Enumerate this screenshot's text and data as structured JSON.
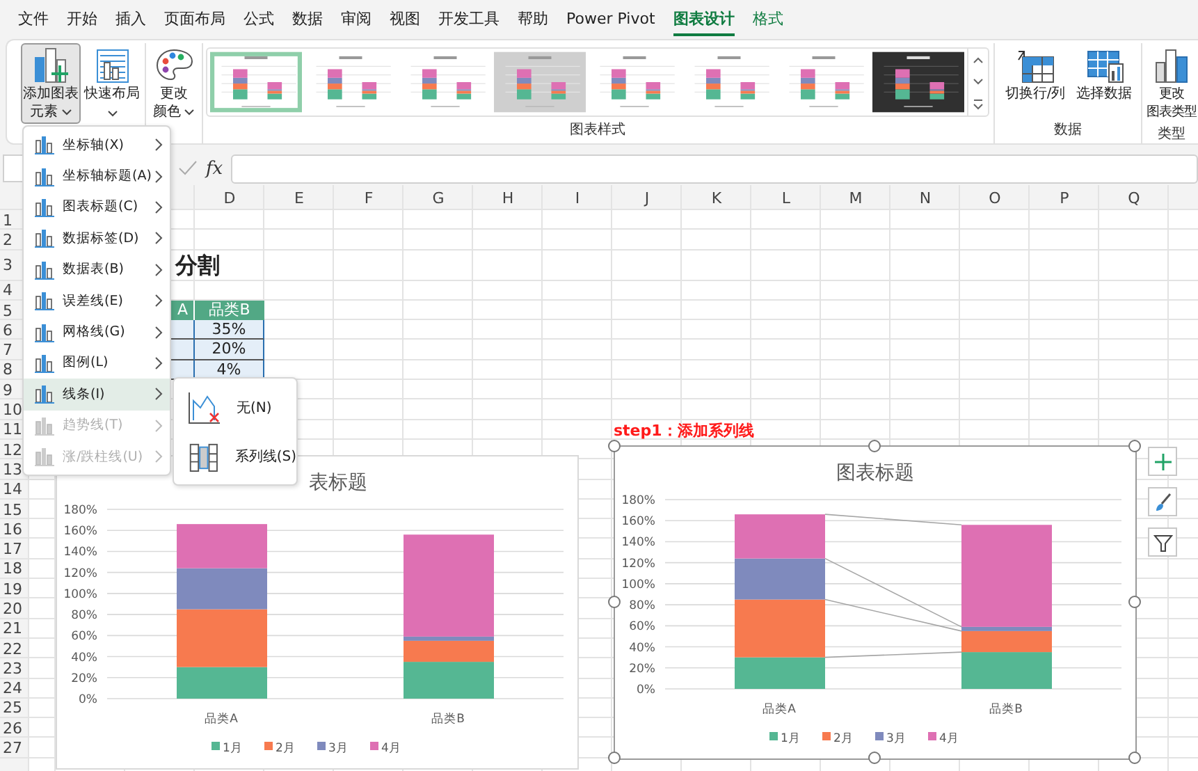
{
  "tabs": [
    {
      "label": "文件",
      "selected": false,
      "contextual": false
    },
    {
      "label": "开始",
      "selected": false,
      "contextual": false
    },
    {
      "label": "插入",
      "selected": false,
      "contextual": false
    },
    {
      "label": "页面布局",
      "selected": false,
      "contextual": false
    },
    {
      "label": "公式",
      "selected": false,
      "contextual": false
    },
    {
      "label": "数据",
      "selected": false,
      "contextual": false
    },
    {
      "label": "审阅",
      "selected": false,
      "contextual": false
    },
    {
      "label": "视图",
      "selected": false,
      "contextual": false
    },
    {
      "label": "开发工具",
      "selected": false,
      "contextual": false
    },
    {
      "label": "帮助",
      "selected": false,
      "contextual": false
    },
    {
      "label": "Power Pivot",
      "selected": false,
      "contextual": false
    },
    {
      "label": "图表设计",
      "selected": true,
      "contextual": true
    },
    {
      "label": "格式",
      "selected": false,
      "contextual": true
    }
  ],
  "ribbon": {
    "layout_buttons": [
      {
        "lines": [
          "添加图表",
          "元素"
        ],
        "dropdown": true,
        "pressed": true
      },
      {
        "lines": [
          "快速布局"
        ],
        "dropdown": true,
        "pressed": false
      }
    ],
    "color_button": {
      "lines": [
        "更改",
        "颜色"
      ],
      "dropdown": true,
      "pressed": false
    },
    "styles": [
      {
        "kind": "plain",
        "selected": true
      },
      {
        "kind": "plain",
        "selected": false
      },
      {
        "kind": "plain",
        "selected": false
      },
      {
        "kind": "gray",
        "selected": false
      },
      {
        "kind": "plain",
        "selected": false
      },
      {
        "kind": "plain",
        "selected": false
      },
      {
        "kind": "plain",
        "selected": false
      },
      {
        "kind": "dark",
        "selected": false
      }
    ],
    "styles_label": "图表样式",
    "data_buttons": [
      {
        "lines": [
          "切换行/列"
        ]
      },
      {
        "lines": [
          "选择数据"
        ]
      }
    ],
    "data_label": "数据",
    "type_button": {
      "lines": [
        "更改",
        "图表类型"
      ]
    },
    "type_label": "类型"
  },
  "formula_bar": {
    "fx": "fx"
  },
  "sheet": {
    "column_headers": [
      "D",
      "E",
      "F",
      "G",
      "H",
      "I",
      "J",
      "K",
      "L",
      "M",
      "N",
      "O",
      "P",
      "Q"
    ],
    "row_headers": [
      "1",
      "2",
      "3",
      "4",
      "5",
      "6",
      "7",
      "8",
      "9",
      "10",
      "11",
      "12",
      "13",
      "14",
      "15",
      "16",
      "17",
      "18",
      "19",
      "20",
      "21",
      "22",
      "23",
      "24",
      "25",
      "26",
      "27"
    ],
    "title": "分割",
    "table": {
      "header": [
        "A",
        "品类B"
      ],
      "values": [
        "35%",
        "20%",
        "4%"
      ]
    },
    "note": "step1：添加系列线",
    "charts": [
      {
        "selected": false,
        "series_lines": false,
        "title_clipped": true,
        "chart_data": {
          "type": "bar",
          "stacked": true,
          "grid": true,
          "legend": true,
          "title": "表标题",
          "categories": [
            "品类A",
            "品类B"
          ],
          "ylim": [
            0,
            180
          ],
          "yticks": [
            {
              "value": 0,
              "label": "0%"
            },
            {
              "value": 20,
              "label": "20%"
            },
            {
              "value": 40,
              "label": "40%"
            },
            {
              "value": 60,
              "label": "60%"
            },
            {
              "value": 80,
              "label": "80%"
            },
            {
              "value": 100,
              "label": "100%"
            },
            {
              "value": 120,
              "label": "120%"
            },
            {
              "value": 140,
              "label": "140%"
            },
            {
              "value": 160,
              "label": "160%"
            },
            {
              "value": 180,
              "label": "180%"
            }
          ],
          "series": [
            {
              "name": "1月",
              "color": "#55b793",
              "values": [
                30,
                35
              ]
            },
            {
              "name": "2月",
              "color": "#f77a4f",
              "values": [
                55,
                20
              ]
            },
            {
              "name": "3月",
              "color": "#7f8abd",
              "values": [
                39,
                4
              ]
            },
            {
              "name": "4月",
              "color": "#de70b3",
              "values": [
                42,
                97
              ]
            }
          ]
        }
      },
      {
        "selected": true,
        "series_lines": true,
        "title_clipped": false,
        "chart_data": {
          "type": "bar",
          "stacked": true,
          "grid": true,
          "legend": true,
          "title": "图表标题",
          "categories": [
            "品类A",
            "品类B"
          ],
          "ylim": [
            0,
            180
          ],
          "yticks": [
            {
              "value": 0,
              "label": "0%"
            },
            {
              "value": 20,
              "label": "20%"
            },
            {
              "value": 40,
              "label": "40%"
            },
            {
              "value": 60,
              "label": "60%"
            },
            {
              "value": 80,
              "label": "80%"
            },
            {
              "value": 100,
              "label": "100%"
            },
            {
              "value": 120,
              "label": "120%"
            },
            {
              "value": 140,
              "label": "140%"
            },
            {
              "value": 160,
              "label": "160%"
            },
            {
              "value": 180,
              "label": "180%"
            }
          ],
          "series": [
            {
              "name": "1月",
              "color": "#55b793",
              "values": [
                30,
                35
              ]
            },
            {
              "name": "2月",
              "color": "#f77a4f",
              "values": [
                55,
                20
              ]
            },
            {
              "name": "3月",
              "color": "#7f8abd",
              "values": [
                39,
                4
              ]
            },
            {
              "name": "4月",
              "color": "#de70b3",
              "values": [
                42,
                97
              ]
            }
          ]
        }
      }
    ]
  },
  "menu": {
    "items": [
      {
        "label": "坐标轴(X)",
        "disabled": false,
        "selected": false
      },
      {
        "label": "坐标轴标题(A)",
        "disabled": false,
        "selected": false
      },
      {
        "label": "图表标题(C)",
        "disabled": false,
        "selected": false
      },
      {
        "label": "数据标签(D)",
        "disabled": false,
        "selected": false
      },
      {
        "label": "数据表(B)",
        "disabled": false,
        "selected": false
      },
      {
        "label": "误差线(E)",
        "disabled": false,
        "selected": false
      },
      {
        "label": "网格线(G)",
        "disabled": false,
        "selected": false
      },
      {
        "label": "图例(L)",
        "disabled": false,
        "selected": false
      },
      {
        "label": "线条(I)",
        "disabled": false,
        "selected": true
      },
      {
        "label": "趋势线(T)",
        "disabled": true,
        "selected": false
      },
      {
        "label": "涨/跌柱线(U)",
        "disabled": true,
        "selected": false
      }
    ],
    "submenu": [
      {
        "label": "无(N)",
        "kind": "none"
      },
      {
        "label": "系列线(S)",
        "kind": "series"
      }
    ]
  }
}
